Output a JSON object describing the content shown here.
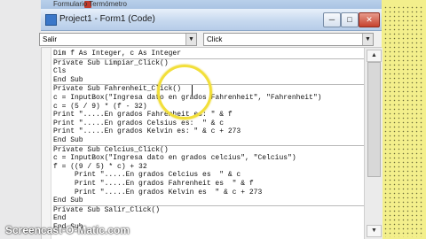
{
  "form_designer": {
    "title": "Formulario Termómetro"
  },
  "window": {
    "title": "Project1 - Form1 (Code)",
    "minimize_glyph": "─",
    "maximize_glyph": "□",
    "close_glyph": "✕"
  },
  "toolbar": {
    "object_combo": {
      "value": "Salir",
      "arrow": "▼"
    },
    "procedure_combo": {
      "value": "Click",
      "arrow": "▼"
    }
  },
  "code": {
    "lines": [
      "Dim f As Integer, c As Integer",
      "Private Sub Limpiar_Click()",
      "Cls",
      "End Sub",
      "Private Sub Fahrenheit_Click()",
      "c = InputBox(\"Ingresa dato en grados Fahrenheit\", \"Fahrenheit\")",
      "c = (5 / 9) * (f - 32)",
      "Print \".....En grados Fahrenheit es: \" & f",
      "Print \".....En grados Celsius es:  \" & c",
      "Print \".....En grados Kelvin es: \" & c + 273",
      "End Sub",
      "Private Sub Celcius_Click()",
      "c = InputBox(\"Ingresa dato en grados celcius\", \"Celcius\")",
      "f = ((9 / 5) * c) + 32",
      "     Print \".....En grados Celcius es  \" & c",
      "     Print \".....En grados Fahrenheit es  \" & f",
      "     Print \".....En grados Kelvin es  \" & c + 273",
      "End Sub",
      "Private Sub Salir_Click()",
      "End",
      "End Sub"
    ]
  },
  "scrollbar": {
    "up_glyph": "▲",
    "down_glyph": "▼"
  },
  "watermark": "Screencast-O-Matic.com",
  "colors": {
    "highlight_circle": "#f2df3a",
    "designer_panel": "#f3ef8c"
  }
}
